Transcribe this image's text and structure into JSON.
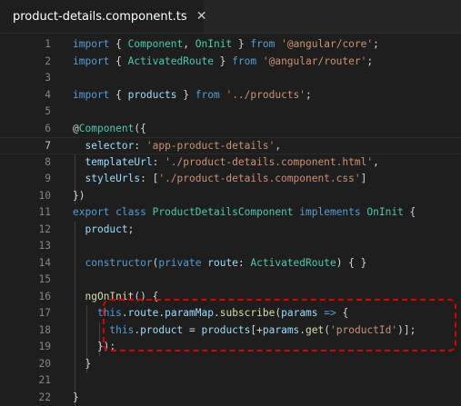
{
  "tab": {
    "title": "product-details.component.ts",
    "close_glyph": "✕",
    "icon": "angular-icon"
  },
  "colors": {
    "background": "#1e1e1e",
    "line_number": "#858585",
    "keyword": "#569cd6",
    "string": "#ce9178",
    "type": "#4ec9b0",
    "highlight_border": "#e00000"
  },
  "editor": {
    "current_line": 7,
    "lines": [
      {
        "n": "1",
        "tokens": [
          [
            "kw",
            "import"
          ],
          [
            "pn",
            " { "
          ],
          [
            "ty",
            "Component"
          ],
          [
            "pn",
            ", "
          ],
          [
            "ty",
            "OnInit"
          ],
          [
            "pn",
            " } "
          ],
          [
            "kw",
            "from"
          ],
          [
            "pn",
            " "
          ],
          [
            "str",
            "'@angular/core'"
          ],
          [
            "pn",
            ";"
          ]
        ]
      },
      {
        "n": "2",
        "tokens": [
          [
            "kw",
            "import"
          ],
          [
            "pn",
            " { "
          ],
          [
            "ty",
            "ActivatedRoute"
          ],
          [
            "pn",
            " } "
          ],
          [
            "kw",
            "from"
          ],
          [
            "pn",
            " "
          ],
          [
            "str",
            "'@angular/router'"
          ],
          [
            "pn",
            ";"
          ]
        ]
      },
      {
        "n": "3",
        "tokens": []
      },
      {
        "n": "4",
        "tokens": [
          [
            "kw",
            "import"
          ],
          [
            "pn",
            " { "
          ],
          [
            "var",
            "products"
          ],
          [
            "pn",
            " } "
          ],
          [
            "kw",
            "from"
          ],
          [
            "pn",
            " "
          ],
          [
            "str",
            "'../products'"
          ],
          [
            "pn",
            ";"
          ]
        ]
      },
      {
        "n": "5",
        "tokens": []
      },
      {
        "n": "6",
        "tokens": [
          [
            "pn",
            "@"
          ],
          [
            "ty",
            "Component"
          ],
          [
            "pn",
            "({"
          ]
        ]
      },
      {
        "n": "7",
        "tokens": [
          [
            "pn",
            "  "
          ],
          [
            "var",
            "selector"
          ],
          [
            "pn",
            ": "
          ],
          [
            "str",
            "'app-product-details'"
          ],
          [
            "pn",
            ","
          ]
        ]
      },
      {
        "n": "8",
        "tokens": [
          [
            "pn",
            "  "
          ],
          [
            "var",
            "templateUrl"
          ],
          [
            "pn",
            ": "
          ],
          [
            "str",
            "'./product-details.component.html'"
          ],
          [
            "pn",
            ","
          ]
        ]
      },
      {
        "n": "9",
        "tokens": [
          [
            "pn",
            "  "
          ],
          [
            "var",
            "styleUrls"
          ],
          [
            "pn",
            ": ["
          ],
          [
            "str",
            "'./product-details.component.css'"
          ],
          [
            "pn",
            "]"
          ]
        ]
      },
      {
        "n": "10",
        "tokens": [
          [
            "pn",
            "})"
          ]
        ]
      },
      {
        "n": "11",
        "tokens": [
          [
            "kw",
            "export"
          ],
          [
            "pn",
            " "
          ],
          [
            "kw",
            "class"
          ],
          [
            "pn",
            " "
          ],
          [
            "ty",
            "ProductDetailsComponent"
          ],
          [
            "pn",
            " "
          ],
          [
            "kw",
            "implements"
          ],
          [
            "pn",
            " "
          ],
          [
            "ty",
            "OnInit"
          ],
          [
            "pn",
            " {"
          ]
        ]
      },
      {
        "n": "12",
        "tokens": [
          [
            "pn",
            "  "
          ],
          [
            "var",
            "product"
          ],
          [
            "pn",
            ";"
          ]
        ]
      },
      {
        "n": "13",
        "tokens": []
      },
      {
        "n": "14",
        "tokens": [
          [
            "pn",
            "  "
          ],
          [
            "kw",
            "constructor"
          ],
          [
            "pn",
            "("
          ],
          [
            "kw",
            "private"
          ],
          [
            "pn",
            " "
          ],
          [
            "var",
            "route"
          ],
          [
            "pn",
            ": "
          ],
          [
            "ty",
            "ActivatedRoute"
          ],
          [
            "pn",
            ") { }"
          ]
        ]
      },
      {
        "n": "15",
        "tokens": []
      },
      {
        "n": "16",
        "tokens": [
          [
            "pn",
            "  "
          ],
          [
            "fn",
            "ngOnInit"
          ],
          [
            "pn",
            "() {"
          ]
        ]
      },
      {
        "n": "17",
        "tokens": [
          [
            "pn",
            "    "
          ],
          [
            "kw",
            "this"
          ],
          [
            "pn",
            "."
          ],
          [
            "var",
            "route"
          ],
          [
            "pn",
            "."
          ],
          [
            "var",
            "paramMap"
          ],
          [
            "pn",
            "."
          ],
          [
            "fn",
            "subscribe"
          ],
          [
            "pn",
            "("
          ],
          [
            "var",
            "params"
          ],
          [
            "pn",
            " "
          ],
          [
            "kw",
            "=>"
          ],
          [
            "pn",
            " {"
          ]
        ]
      },
      {
        "n": "18",
        "tokens": [
          [
            "pn",
            "      "
          ],
          [
            "kw",
            "this"
          ],
          [
            "pn",
            "."
          ],
          [
            "var",
            "product"
          ],
          [
            "pn",
            " = "
          ],
          [
            "var",
            "products"
          ],
          [
            "pn",
            "[+"
          ],
          [
            "var",
            "params"
          ],
          [
            "pn",
            "."
          ],
          [
            "fn",
            "get"
          ],
          [
            "pn",
            "("
          ],
          [
            "str",
            "'productId'"
          ],
          [
            "pn",
            ")];"
          ]
        ]
      },
      {
        "n": "19",
        "tokens": [
          [
            "pn",
            "    });"
          ]
        ]
      },
      {
        "n": "20",
        "tokens": [
          [
            "pn",
            "  }"
          ]
        ]
      },
      {
        "n": "21",
        "tokens": []
      },
      {
        "n": "22",
        "tokens": [
          [
            "pn",
            "}"
          ]
        ]
      }
    ]
  }
}
